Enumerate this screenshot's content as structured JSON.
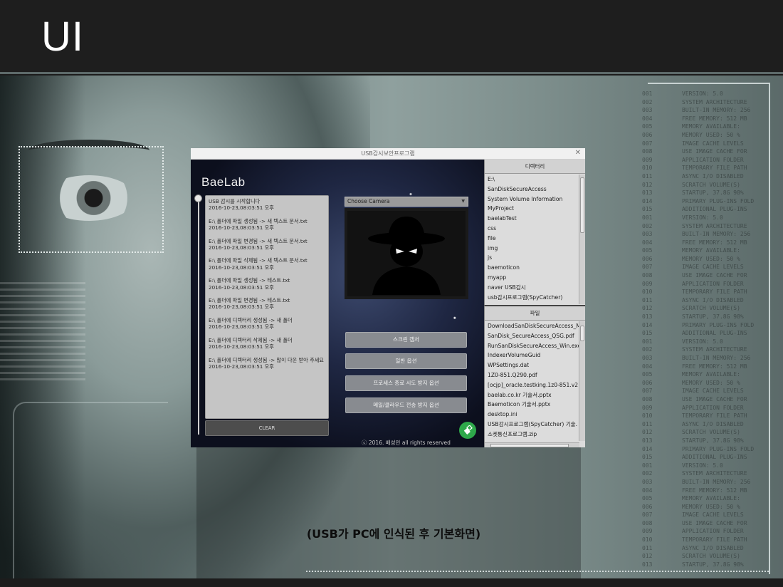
{
  "slide": {
    "title": "UI",
    "caption": "(USB가 PC에 인식된 후 기본화면)"
  },
  "background_code": [
    [
      "001",
      "VERSION: 5.0"
    ],
    [
      "002",
      "SYSTEM ARCHITECTURE"
    ],
    [
      "003",
      "BUILT-IN MEMORY: 256"
    ],
    [
      "004",
      "FREE MEMORY: 512 MB"
    ],
    [
      "005",
      "MEMORY AVAILABLE:"
    ],
    [
      "006",
      "MEMORY USED: 50 %"
    ],
    [
      "007",
      "IMAGE CACHE LEVELS"
    ],
    [
      "008",
      "USE IMAGE CACHE FOR"
    ],
    [
      "009",
      "APPLICATION FOLDER"
    ],
    [
      "010",
      "TEMPORARY FILE PATH"
    ],
    [
      "011",
      "ASYNC I/O DISABLED"
    ],
    [
      "012",
      "SCRATCH VOLUME(S)"
    ],
    [
      "013",
      "STARTUP, 37.8G 98%"
    ],
    [
      "014",
      "PRIMARY PLUG-INS FOLD"
    ],
    [
      "015",
      "ADDITIONAL PLUG-INS"
    ],
    [
      "001",
      "VERSION: 5.0"
    ],
    [
      "002",
      "SYSTEM ARCHITECTURE"
    ],
    [
      "003",
      "BUILT-IN MEMORY: 256"
    ],
    [
      "004",
      "FREE MEMORY: 512 MB"
    ],
    [
      "005",
      "MEMORY AVAILABLE:"
    ],
    [
      "006",
      "MEMORY USED: 50 %"
    ],
    [
      "007",
      "IMAGE CACHE LEVELS"
    ],
    [
      "008",
      "USE IMAGE CACHE FOR"
    ],
    [
      "009",
      "APPLICATION FOLDER"
    ],
    [
      "010",
      "TEMPORARY FILE PATH"
    ],
    [
      "011",
      "ASYNC I/O DISABLED"
    ],
    [
      "012",
      "SCRATCH VOLUME(S)"
    ],
    [
      "013",
      "STARTUP, 37.8G 98%"
    ],
    [
      "014",
      "PRIMARY PLUG-INS FOLD"
    ],
    [
      "015",
      "ADDITIONAL PLUG-INS"
    ],
    [
      "001",
      "VERSION: 5.0"
    ],
    [
      "002",
      "SYSTEM ARCHITECTURE"
    ],
    [
      "003",
      "BUILT-IN MEMORY: 256"
    ],
    [
      "004",
      "FREE MEMORY: 512 MB"
    ],
    [
      "005",
      "MEMORY AVAILABLE:"
    ],
    [
      "006",
      "MEMORY USED: 50 %"
    ],
    [
      "007",
      "IMAGE CACHE LEVELS"
    ],
    [
      "008",
      "USE IMAGE CACHE FOR"
    ],
    [
      "009",
      "APPLICATION FOLDER"
    ],
    [
      "010",
      "TEMPORARY FILE PATH"
    ],
    [
      "011",
      "ASYNC I/O DISABLED"
    ],
    [
      "012",
      "SCRATCH VOLUME(S)"
    ],
    [
      "013",
      "STARTUP, 37.8G 98%"
    ],
    [
      "014",
      "PRIMARY PLUG-INS FOLD"
    ],
    [
      "015",
      "ADDITIONAL PLUG-INS"
    ],
    [
      "001",
      "VERSION: 5.0"
    ],
    [
      "002",
      "SYSTEM ARCHITECTURE"
    ],
    [
      "003",
      "BUILT-IN MEMORY: 256"
    ],
    [
      "004",
      "FREE MEMORY: 512 MB"
    ],
    [
      "005",
      "MEMORY AVAILABLE:"
    ],
    [
      "006",
      "MEMORY USED: 50 %"
    ],
    [
      "007",
      "IMAGE CACHE LEVELS"
    ],
    [
      "008",
      "USE IMAGE CACHE FOR"
    ],
    [
      "009",
      "APPLICATION FOLDER"
    ],
    [
      "010",
      "TEMPORARY FILE PATH"
    ],
    [
      "011",
      "ASYNC I/O DISABLED"
    ],
    [
      "012",
      "SCRATCH VOLUME(S)"
    ],
    [
      "013",
      "STARTUP, 37.8G 98%"
    ]
  ],
  "app": {
    "window_title": "USB감시보안프로그램",
    "close_glyph": "✕",
    "brand": "BaeLab",
    "log_entries": [
      {
        "msg": "USB 감시를 시작합니다",
        "ts": "2016-10-23,08:03:51 오후"
      },
      {
        "msg": "E:\\ 폴더에 파일 생성됨 -> 새 텍스트 문서.txt",
        "ts": "2016-10-23,08:03:51 오후"
      },
      {
        "msg": "E:\\ 폴더에 파일 변경됨 -> 새 텍스트 문서.txt",
        "ts": "2016-10-23,08:03:51 오후"
      },
      {
        "msg": "E:\\ 폴더에 파일 삭제됨 -> 새 텍스트 문서.txt",
        "ts": "2016-10-23,08:03:51 오후"
      },
      {
        "msg": "E:\\ 폴더에 파일 생성됨 -> 테스트.txt",
        "ts": "2016-10-23,08:03:51 오후"
      },
      {
        "msg": "E:\\ 폴더에 파일 변경됨 -> 테스트.txt",
        "ts": "2016-10-23,08:03:51 오후"
      },
      {
        "msg": "E:\\ 폴더에 디렉터리 생성됨 -> 새 폴더",
        "ts": "2016-10-23,08:03:51 오후"
      },
      {
        "msg": "E:\\ 폴더에 디렉터리 삭제됨 -> 새 폴더",
        "ts": "2016-10-23,08:03:51 오후"
      },
      {
        "msg": "E:\\ 폴더에 디렉터리 생성됨 -> 많이 다운 받아 주세요",
        "ts": "2016-10-23,08:03:51 오후"
      }
    ],
    "clear_label": "CLEAR",
    "camera_select": "Choose Camera",
    "buttons": {
      "screen_capture": "스크린 캡처",
      "basic_option": "일반 옵션",
      "process_option": "프로세스 종료 시도 방지 옵션",
      "mail_option": "메일/클라우드 전송 방지 옵션"
    },
    "copyright": "ⓒ 2016. 배성민 all rights reserved",
    "directory_panel": {
      "header": "디렉터리",
      "items": [
        "E:\\",
        "SanDiskSecureAccess",
        "System Volume Information",
        "MyProject",
        "baelabTest",
        "css",
        "file",
        "img",
        "js",
        "baemoticon",
        "myapp",
        "naver USB감시",
        "usb감시프로그램(SpyCatcher)"
      ]
    },
    "file_panel": {
      "header": "파일",
      "items": [
        "DownloadSanDiskSecureAccess_M",
        "SanDisk_SecureAccess_QSG.pdf",
        "RunSanDiskSecureAccess_Win.exe",
        "IndexerVolumeGuid",
        "WPSettings.dat",
        "1Z0-851.Q290.pdf",
        "[ocjp]_oracle.testking.1z0-851.v2",
        "baelab.co.kr 기술서.pptx",
        "Baemoticon 기술서.pptx",
        "desktop.ini",
        "USB감시프로그램(SpyCatcher) 기술.",
        "소켓통신프로그램.zip"
      ]
    }
  }
}
